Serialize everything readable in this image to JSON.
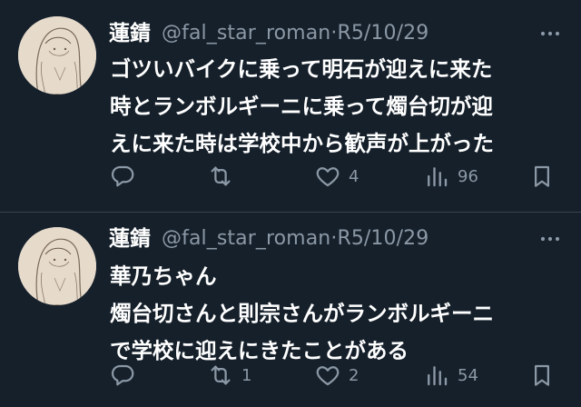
{
  "colors": {
    "background": "#15202b",
    "divider": "#38444d",
    "text_primary": "#ffffff",
    "text_secondary": "#8b98a5"
  },
  "tweets": [
    {
      "display_name": "蓮錆",
      "handle": "@fal_star_roman",
      "separator": "·",
      "date": "R5/10/29",
      "more_icon": "more-dots-icon",
      "text_lines": [
        "ゴツいバイクに乗って明石が迎えに来た",
        "時とランボルギーニに乗って燭台切が迎",
        "えに来た時は学校中から歓声が上がった"
      ],
      "actions": {
        "reply": {
          "icon": "reply-icon",
          "count": ""
        },
        "retweet": {
          "icon": "retweet-icon",
          "count": ""
        },
        "like": {
          "icon": "heart-icon",
          "count": "4"
        },
        "views": {
          "icon": "views-icon",
          "count": "96"
        },
        "bookmark": {
          "icon": "bookmark-icon",
          "count": ""
        }
      }
    },
    {
      "display_name": "蓮錆",
      "handle": "@fal_star_roman",
      "separator": "·",
      "date": "R5/10/29",
      "more_icon": "more-dots-icon",
      "text_lines": [
        "華乃ちゃん",
        "燭台切さんと則宗さんがランボルギーニ",
        "で学校に迎えにきたことがある"
      ],
      "actions": {
        "reply": {
          "icon": "reply-icon",
          "count": ""
        },
        "retweet": {
          "icon": "retweet-icon",
          "count": "1"
        },
        "like": {
          "icon": "heart-icon",
          "count": "2"
        },
        "views": {
          "icon": "views-icon",
          "count": "54"
        },
        "bookmark": {
          "icon": "bookmark-icon",
          "count": ""
        }
      }
    }
  ]
}
